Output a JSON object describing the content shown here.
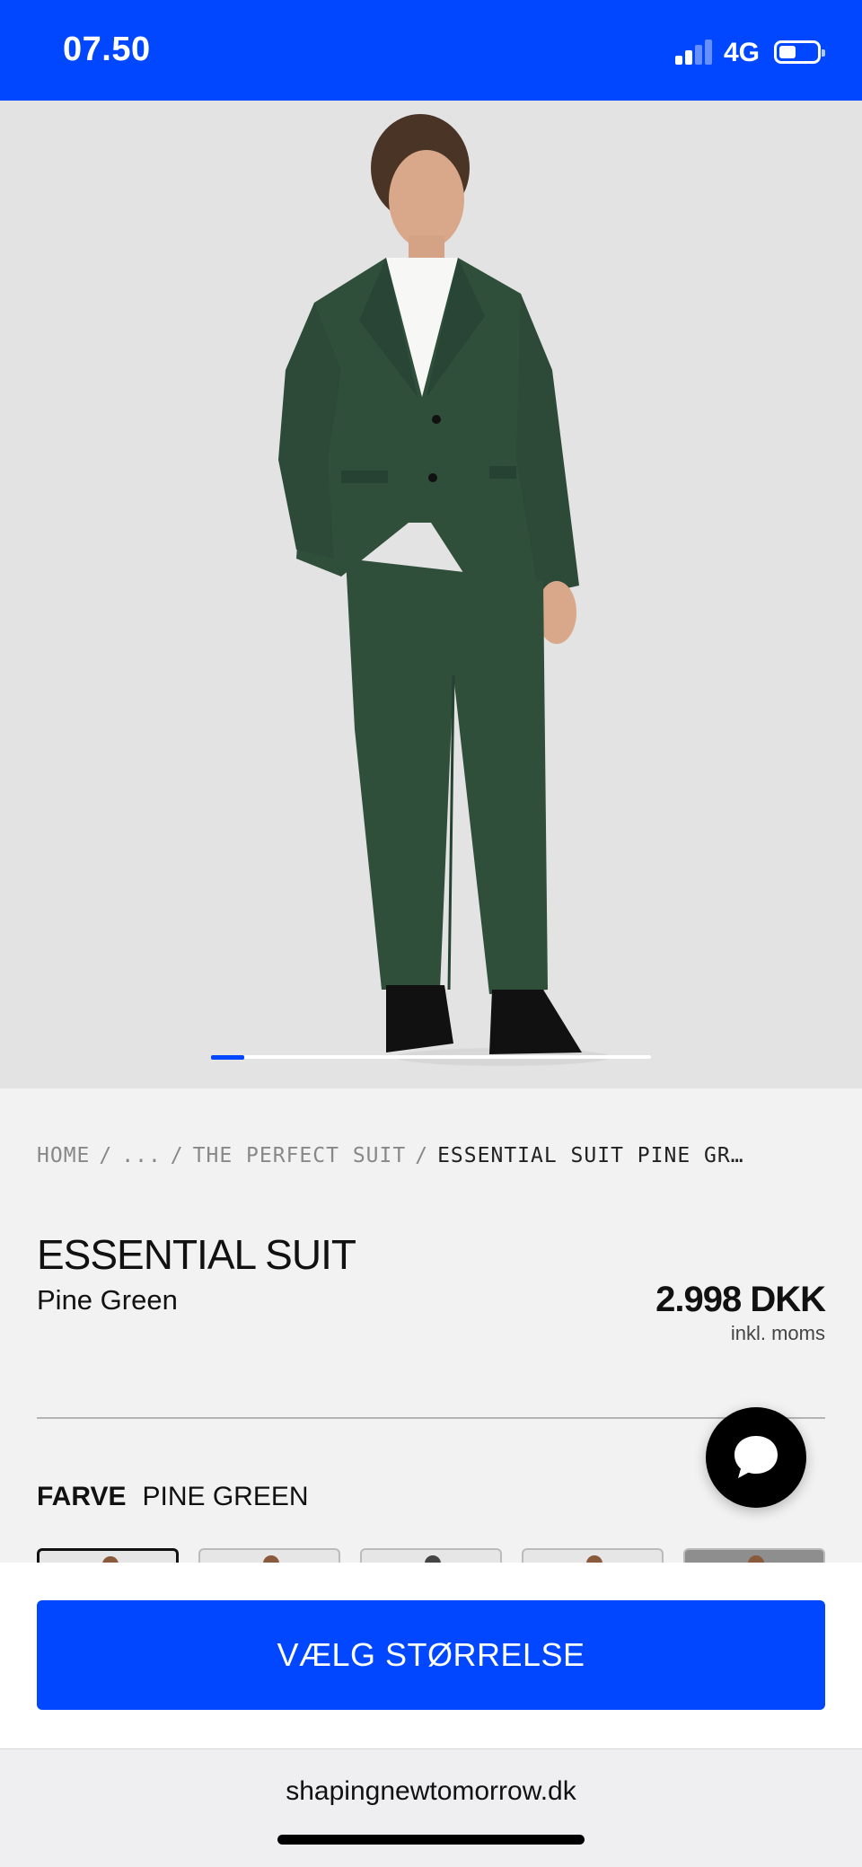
{
  "status_bar": {
    "time": "07.50",
    "network": "4G",
    "signal_bars_active": 2,
    "signal_bars_total": 4,
    "battery_level": 0.45
  },
  "gallery": {
    "image_alt": "Model wearing pine green suit",
    "current_index": 1
  },
  "breadcrumb": {
    "items": [
      "HOME",
      "...",
      "THE PERFECT SUIT",
      "ESSENTIAL SUIT PINE GR…"
    ],
    "separator": "/"
  },
  "product": {
    "name": "ESSENTIAL SUIT",
    "color_name": "Pine Green",
    "price": "2.998 DKK",
    "price_note": "inkl. moms"
  },
  "color_selector": {
    "label": "FARVE",
    "value": "PINE GREEN",
    "selected_index": 0
  },
  "cta": {
    "label": "VÆLG STØRRELSE"
  },
  "browser": {
    "url": "shapingnewtomorrow.dk"
  },
  "icons": {
    "chat": "chat-bubble-icon",
    "signal": "cellular-signal-icon",
    "battery": "battery-icon"
  },
  "colors": {
    "brand_blue": "#0047ff",
    "suit_green": "#2f4f3a",
    "background": "#f2f2f2"
  }
}
